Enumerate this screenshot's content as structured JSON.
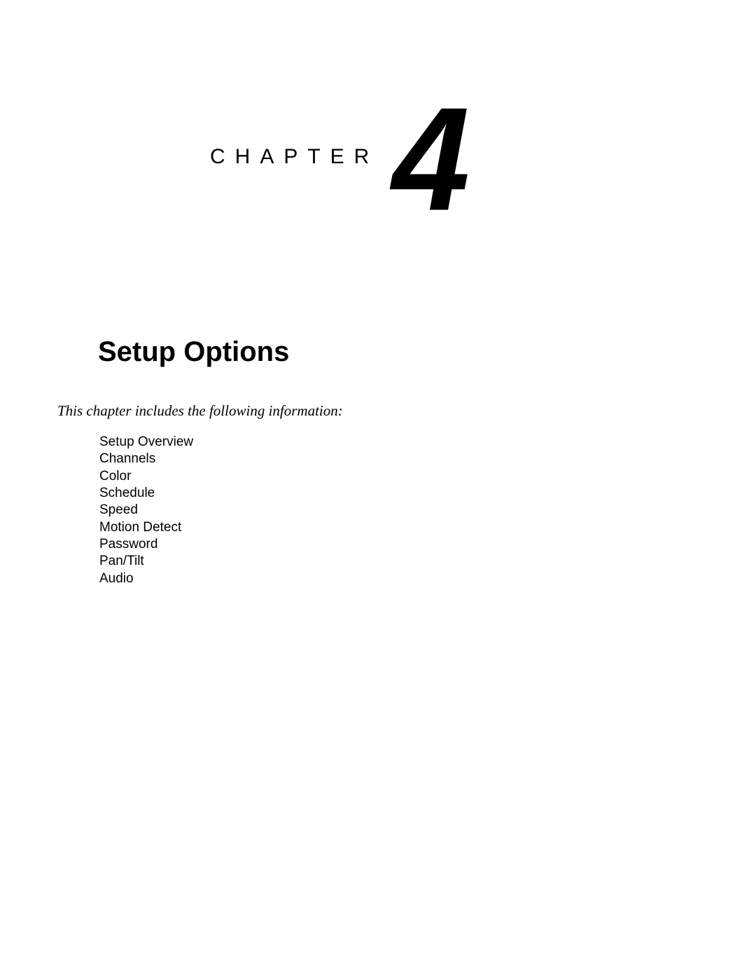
{
  "chapter": {
    "label": "CHAPTER",
    "number": "4",
    "title": "Setup Options",
    "intro": "This chapter includes the following information:",
    "topics": [
      "Setup Overview",
      "Channels",
      "Color",
      "Schedule",
      "Speed",
      "Motion Detect",
      "Password",
      "Pan/Tilt",
      "Audio"
    ]
  }
}
